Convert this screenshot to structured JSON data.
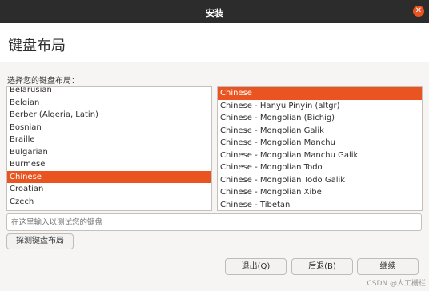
{
  "window": {
    "title": "安装",
    "close_icon": "close-icon"
  },
  "header": {
    "title": "键盘布局"
  },
  "prompt": "选择您的键盘布局：",
  "layouts": {
    "items": [
      "Belarusian",
      "Belgian",
      "Berber (Algeria, Latin)",
      "Bosnian",
      "Braille",
      "Bulgarian",
      "Burmese",
      "Chinese",
      "Croatian",
      "Czech"
    ],
    "selected_index": 7
  },
  "variants": {
    "items": [
      "Chinese",
      "Chinese - Hanyu Pinyin (altgr)",
      "Chinese - Mongolian (Bichig)",
      "Chinese - Mongolian Galik",
      "Chinese - Mongolian Manchu",
      "Chinese - Mongolian Manchu Galik",
      "Chinese - Mongolian Todo",
      "Chinese - Mongolian Todo Galik",
      "Chinese - Mongolian Xibe",
      "Chinese - Tibetan"
    ],
    "selected_index": 0
  },
  "test_input": {
    "placeholder": "在这里输入以测试您的键盘",
    "value": ""
  },
  "buttons": {
    "detect": "探测键盘布局",
    "quit": "退出(Q)",
    "back": "后退(B)",
    "continue": "继续"
  },
  "watermark": "CSDN @人工栅栏",
  "colors": {
    "accent": "#e95420",
    "titlebar": "#2c2c2c"
  }
}
